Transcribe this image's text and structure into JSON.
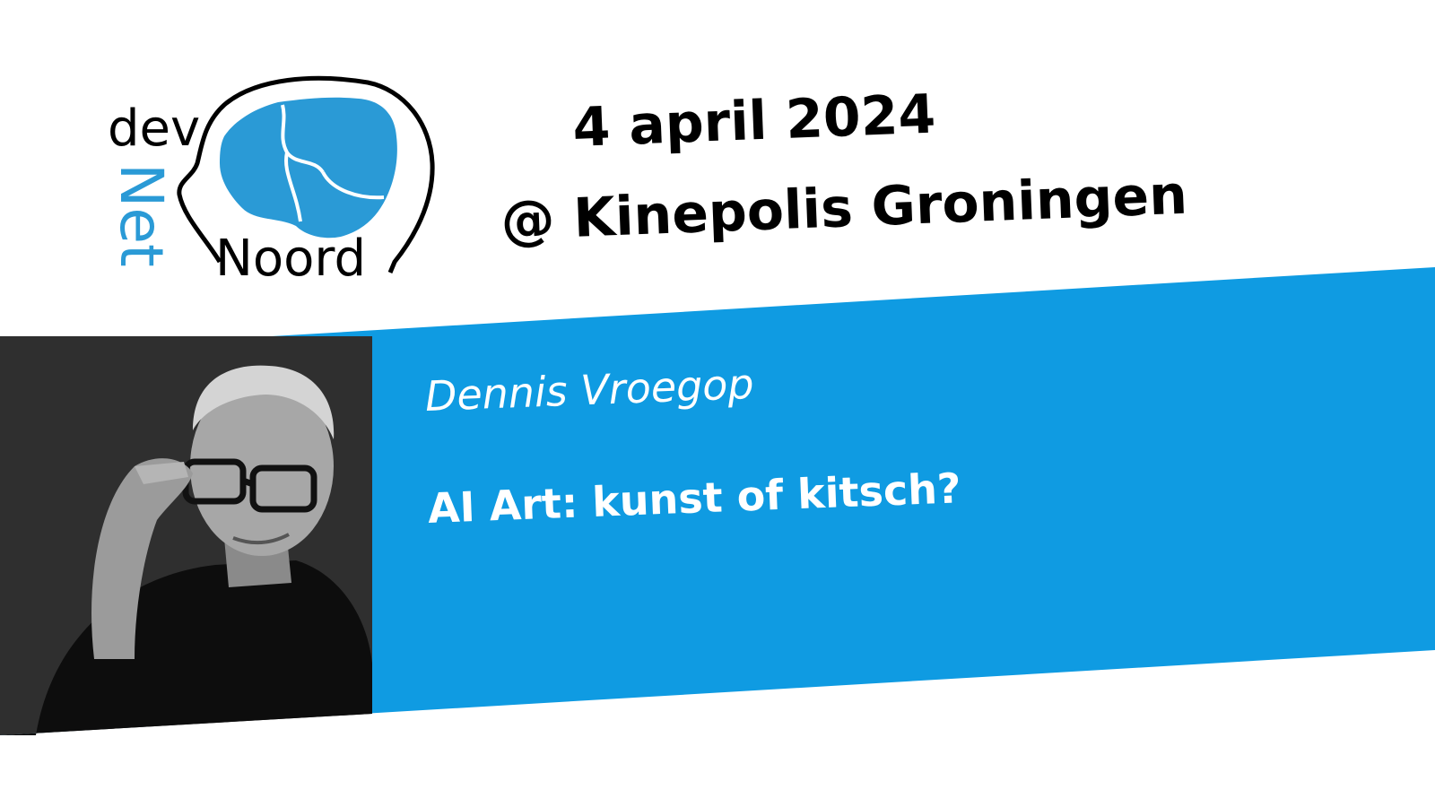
{
  "logo": {
    "word_dev": "dev",
    "word_net": "Net",
    "word_noord": "Noord",
    "accent_color": "#2a9ad6"
  },
  "event": {
    "date": "4 april 2024",
    "venue": "@ Kinepolis Groningen"
  },
  "session": {
    "speaker": "Dennis Vroegop",
    "title": "AI Art: kunst of kitsch?"
  },
  "colors": {
    "band": "#0f9be2",
    "photo_background": "#2e2e2e",
    "text_dark": "#000000",
    "text_light": "#ffffff"
  },
  "photo": {
    "icon": "speaker-portrait"
  }
}
